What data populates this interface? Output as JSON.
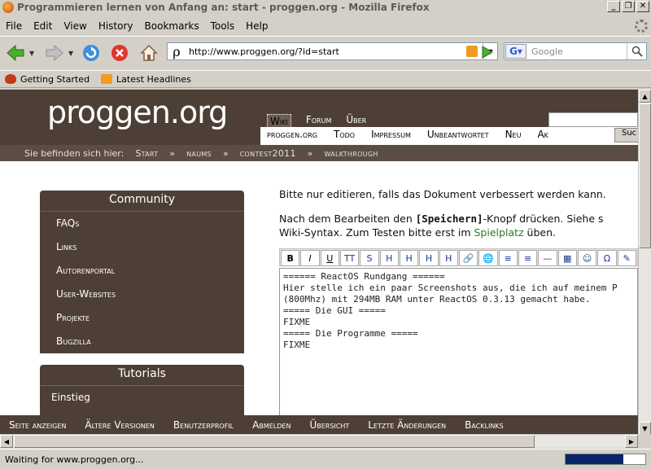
{
  "window": {
    "title": "Programmieren lernen von Anfang an: start - proggen.org - Mozilla Firefox",
    "buttons": [
      "_",
      "❐",
      "✕"
    ]
  },
  "menubar": {
    "items": [
      {
        "label": "File"
      },
      {
        "label": "Edit"
      },
      {
        "label": "View"
      },
      {
        "label": "History"
      },
      {
        "label": "Bookmarks"
      },
      {
        "label": "Tools"
      },
      {
        "label": "Help"
      }
    ]
  },
  "navbar": {
    "url": "http://www.proggen.org/?id=start",
    "search_placeholder": "Google"
  },
  "bookmarks": {
    "items": [
      {
        "label": "Getting Started",
        "icon": "firefox-icon"
      },
      {
        "label": "Latest Headlines",
        "icon": "rss-icon"
      }
    ]
  },
  "site": {
    "logo": "proggen.org",
    "topnav_primary": [
      "Wiki",
      "Forum",
      "Über"
    ],
    "topnav_secondary": [
      "proggen.org",
      "Todo",
      "Impressum",
      "Unbeantwortet",
      "Neu",
      "Ak"
    ],
    "search_button": "Suc",
    "breadcrumb": {
      "prefix": "Sie befinden sich hier:",
      "items": [
        "Start",
        "naums",
        "contest2011",
        "walkthrough"
      ],
      "separator": "»"
    },
    "community": {
      "title": "Community",
      "items": [
        "FAQs",
        "Links",
        "Autorenportal",
        "User-Websites",
        "Projekte",
        "Bugzilla"
      ]
    },
    "tutorials": {
      "title": "Tutorials",
      "items": [
        "Einstieg"
      ]
    },
    "content": {
      "line1": "Bitte nur editieren, falls das Dokument verbessert werden kann.",
      "line2_pre": "Nach dem Bearbeiten den ",
      "line2_btn": "[Speichern]",
      "line2_post": "-Knopf drücken. Siehe s",
      "line3_pre": "Wiki-Syntax. Zum Testen bitte erst im ",
      "line3_link": "Spielplatz",
      "line3_post": " üben."
    },
    "editor_toolbar": [
      "B",
      "I",
      "U",
      "TT",
      "S",
      "H",
      "H",
      "H",
      "H",
      "🔗",
      "🌐",
      "≡",
      "≡",
      "—",
      "▦",
      "☺",
      "Ω",
      "✎"
    ],
    "editor_lines": [
      "====== ReactOS Rundgang ======",
      "",
      "Hier stelle ich ein paar Screenshots aus, die ich auf meinem P",
      "(800Mhz) mit 294MB RAM unter ReactOS 0.3.13 gemacht habe.",
      "",
      "===== Die GUI =====",
      "",
      "FIXME",
      "",
      "===== Die Programme =====",
      "",
      "FIXME"
    ],
    "footer": [
      "Seite anzeigen",
      "Ältere Versionen",
      "Benutzerprofil",
      "Abmelden",
      "Übersicht",
      "Letzte Änderungen",
      "Backlinks"
    ]
  },
  "status": {
    "text": "Waiting for www.proggen.org...",
    "progress_fraction": 0.72
  },
  "colors": {
    "site_brown": "#4d3f35",
    "link_green": "#2a7a2a",
    "progress": "#0a246a"
  }
}
